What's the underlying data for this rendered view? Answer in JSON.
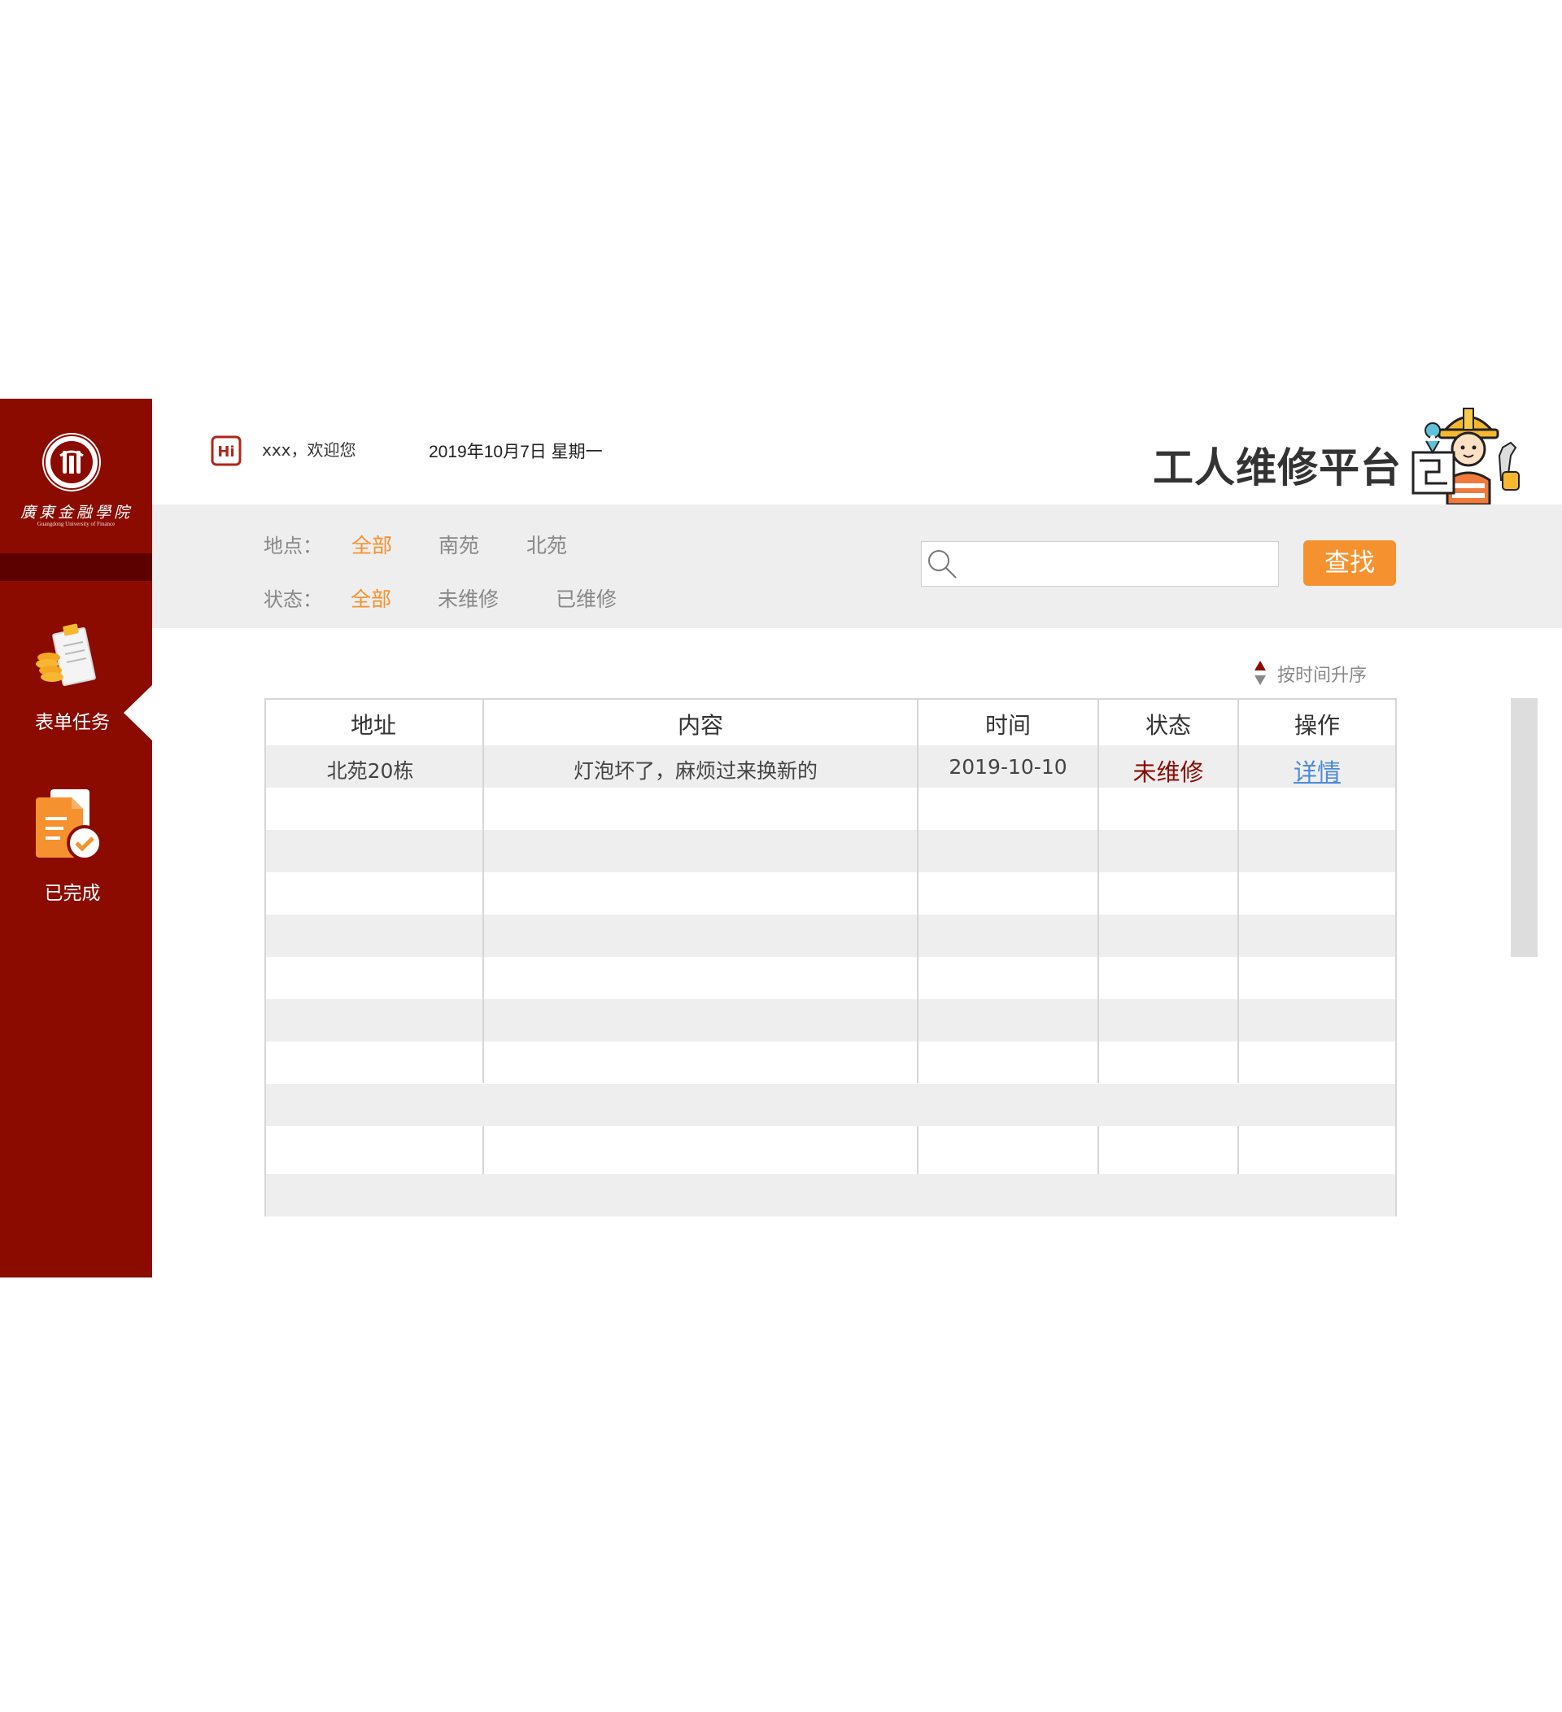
{
  "sidebar": {
    "logo_text": "廣東金融學院",
    "logo_subtitle": "Guangdong University of Finance",
    "items": [
      {
        "label": "表单任务",
        "active": true
      },
      {
        "label": "已完成",
        "active": false
      }
    ]
  },
  "header": {
    "hi_badge": "Hi",
    "welcome": "xxx，欢迎您",
    "date": "2019年10月7日  星期一",
    "title": "工人维修平台"
  },
  "filters": {
    "location_label": "地点：",
    "location_options": [
      "全部",
      "南苑",
      "北苑"
    ],
    "location_selected": "全部",
    "status_label": "状态：",
    "status_options": [
      "全部",
      "未维修",
      "已维修"
    ],
    "status_selected": "全部",
    "search_placeholder": "",
    "search_button": "查找"
  },
  "sort": {
    "label": "按时间升序"
  },
  "table": {
    "columns": [
      "地址",
      "内容",
      "时间",
      "状态",
      "操作"
    ],
    "rows": [
      {
        "address": "北苑20栋",
        "content": "灯泡坏了，麻烦过来换新的",
        "time": "2019-10-10",
        "status": "未维修",
        "action": "详情"
      }
    ]
  },
  "colors": {
    "sidebar": "#8b0b00",
    "accent": "#f5922f",
    "status_pending": "#8b0b00",
    "link": "#4a8bd8",
    "filter_bg": "#eeeeee"
  }
}
